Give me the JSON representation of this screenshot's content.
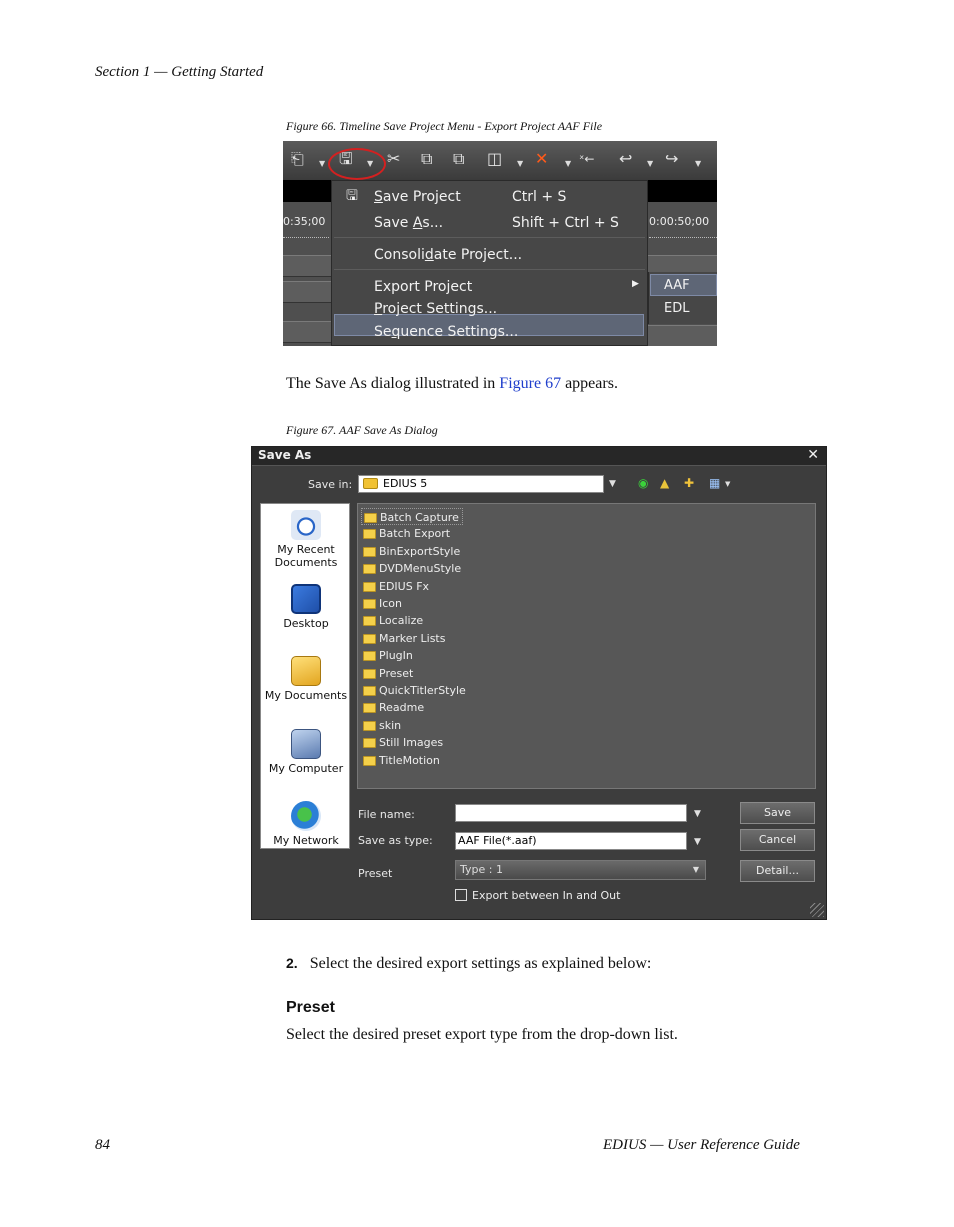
{
  "header": {
    "section": "Section 1 — Getting Started"
  },
  "figure66": {
    "caption": "Figure 66.  Timeline Save Project Menu - Export Project AAF File",
    "timecode_left": "0:35;00",
    "timecode_right": "0:00:50;00",
    "menu": {
      "save_project": "ave Project",
      "save_project_accel": "S",
      "save_project_shortcut": "Ctrl + S",
      "save_as_pre": "Save ",
      "save_as_accel": "A",
      "save_as_post": "s...",
      "save_as_shortcut": "Shift + Ctrl + S",
      "consolidate_pre": "Consoli",
      "consolidate_accel": "d",
      "consolidate_post": "ate Project...",
      "export_project": "Export Project",
      "project_settings_accel": "P",
      "project_settings": "roject Settings...",
      "sequence_settings_pre": "Se",
      "sequence_settings_accel": "q",
      "sequence_settings_post": "uence Settings..."
    },
    "submenu": {
      "aaf": "AAF",
      "edl": "EDL"
    }
  },
  "body_text_1": {
    "before": "The Save As dialog illustrated in ",
    "link": "Figure 67",
    "after": " appears."
  },
  "figure67": {
    "caption": "Figure 67.  AAF Save As Dialog",
    "dialog": {
      "title": "Save As",
      "save_in_label": "Save in:",
      "save_in_value": "EDIUS 5",
      "places": [
        "My Recent Documents",
        "Desktop",
        "My Documents",
        "My Computer",
        "My Network"
      ],
      "files": [
        "Batch Capture",
        "Batch Export",
        "BinExportStyle",
        "DVDMenuStyle",
        "EDIUS Fx",
        "Icon",
        "Localize",
        "Marker Lists",
        "PlugIn",
        "Preset",
        "QuickTitlerStyle",
        "Readme",
        "skin",
        "Still Images",
        "TitleMotion"
      ],
      "file_name_label": "File name:",
      "file_name_value": "",
      "save_as_type_label": "Save as type:",
      "save_as_type_value": "AAF File(*.aaf)",
      "preset_label": "Preset",
      "preset_value": "Type : 1",
      "save_button": "Save",
      "cancel_button": "Cancel",
      "detail_button": "Detail...",
      "export_between": "Export between In and Out"
    }
  },
  "step2": {
    "number": "2.",
    "text": "Select the desired export settings as explained below:"
  },
  "preset_section": {
    "heading": "Preset",
    "text": "Select the desired preset export type from the drop-down list."
  },
  "footer": {
    "page_number": "84",
    "title": "EDIUS  —  User Reference Guide"
  }
}
